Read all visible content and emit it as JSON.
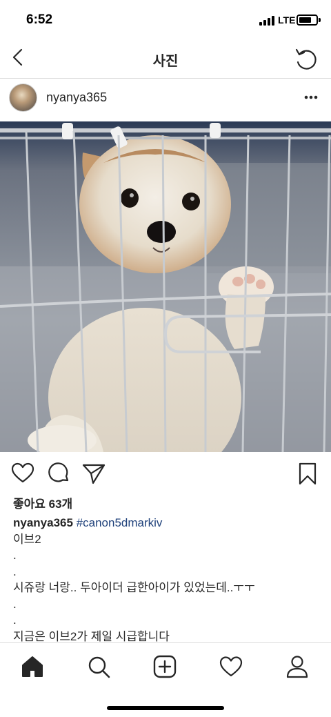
{
  "status_bar": {
    "time": "6:52",
    "network": "LTE"
  },
  "nav": {
    "title": "사진",
    "back_icon": "chevron-left-icon",
    "refresh_icon": "refresh-icon"
  },
  "post": {
    "username": "nyanya365",
    "more_icon": "more-horizontal-icon",
    "likes": "좋아요 63개",
    "caption": {
      "username": "nyanya365",
      "hashtag": "#canon5dmarkiv",
      "lines": [
        "이브2",
        ".",
        ".",
        "시쥬랑 너랑.. 두아이더 급한아이가 있었는데..ㅜㅜ",
        ".",
        ".",
        "지금은 이브2가 제일 시급합니다"
      ]
    }
  },
  "actions": {
    "like_icon": "heart-icon",
    "comment_icon": "comment-icon",
    "share_icon": "send-icon",
    "save_icon": "bookmark-icon"
  },
  "tab_bar": {
    "items": [
      "home-icon",
      "search-icon",
      "add-post-icon",
      "activity-heart-icon",
      "profile-icon"
    ]
  },
  "colors": {
    "text": "#262626",
    "hashtag": "#20427b",
    "divider": "#dbdbdb"
  }
}
